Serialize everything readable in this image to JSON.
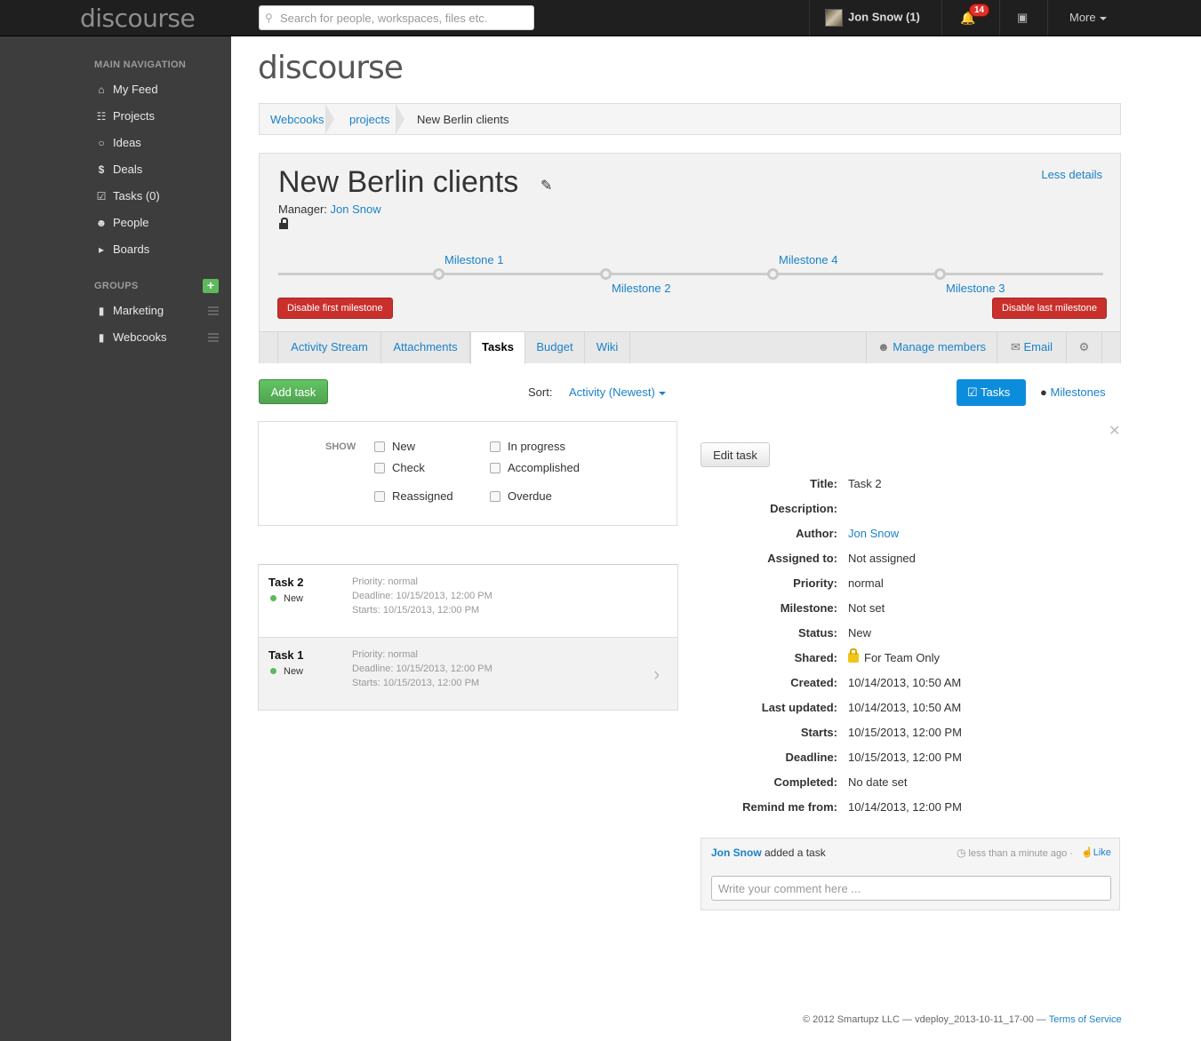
{
  "topbar": {
    "logo": "discourse",
    "search_placeholder": "Search for people, workspaces, files etc.",
    "user": "Jon Snow (1)",
    "notifications_count": "14",
    "more_label": "More"
  },
  "sidebar": {
    "main_nav_header": "MAIN NAVIGATION",
    "items": [
      {
        "label": "My Feed",
        "icon": "home-icon"
      },
      {
        "label": "Projects",
        "icon": "file-icon"
      },
      {
        "label": "Ideas",
        "icon": "lightbulb-icon"
      },
      {
        "label": "Deals",
        "icon": "dollar-icon"
      },
      {
        "label": "Tasks (0)",
        "icon": "check-square-icon"
      },
      {
        "label": "People",
        "icon": "users-icon"
      },
      {
        "label": "Boards",
        "icon": "megaphone-icon"
      }
    ],
    "groups_header": "GROUPS",
    "groups": [
      {
        "label": "Marketing",
        "icon": "bookmark-icon"
      },
      {
        "label": "Webcooks",
        "icon": "bookmark-icon"
      }
    ]
  },
  "main": {
    "logo": "discourse",
    "breadcrumb": [
      "Webcooks",
      "projects",
      "New Berlin clients"
    ],
    "project": {
      "title": "New Berlin clients",
      "less_details": "Less details",
      "manager_label": "Manager:",
      "manager_name": "Jon Snow",
      "milestones": [
        "Milestone 1",
        "Milestone 2",
        "Milestone 4",
        "Milestone 3"
      ],
      "disable_first": "Disable first milestone",
      "disable_last": "Disable last milestone"
    },
    "tabs": [
      "Activity Stream",
      "Attachments",
      "Tasks",
      "Budget",
      "Wiki"
    ],
    "active_tab": "Tasks",
    "tab_actions": {
      "manage_members": "Manage members",
      "email": "Email"
    },
    "add_task": "Add task",
    "sort_label": "Sort:",
    "sort_value": "Activity (Newest)",
    "view_tasks": "Tasks",
    "view_milestones": "Milestones",
    "filter": {
      "show_label": "SHOW",
      "options": [
        "New",
        "In progress",
        "Check",
        "Accomplished",
        "Reassigned",
        "Overdue"
      ]
    },
    "tasks": [
      {
        "name": "Task 2",
        "status": "New",
        "priority": "Priority: normal",
        "deadline": "Deadline: 10/15/2013, 12:00 PM",
        "starts": "Starts: 10/15/2013, 12:00 PM"
      },
      {
        "name": "Task 1",
        "status": "New",
        "priority": "Priority: normal",
        "deadline": "Deadline: 10/15/2013, 12:00 PM",
        "starts": "Starts: 10/15/2013, 12:00 PM"
      }
    ],
    "detail": {
      "edit_task": "Edit task",
      "fields": [
        {
          "k": "Title:",
          "v": "Task 2"
        },
        {
          "k": "Description:",
          "v": ""
        },
        {
          "k": "Author:",
          "v": "Jon Snow"
        },
        {
          "k": "Assigned to:",
          "v": "Not assigned"
        },
        {
          "k": "Priority:",
          "v": "normal"
        },
        {
          "k": "Milestone:",
          "v": "Not set"
        },
        {
          "k": "Status:",
          "v": "New"
        },
        {
          "k": "Shared:",
          "v": "For Team Only"
        },
        {
          "k": "Created:",
          "v": "10/14/2013, 10:50 AM"
        },
        {
          "k": "Last updated:",
          "v": "10/14/2013, 10:50 AM"
        },
        {
          "k": "Starts:",
          "v": "10/15/2013, 12:00 PM"
        },
        {
          "k": "Deadline:",
          "v": "10/15/2013, 12:00 PM"
        },
        {
          "k": "Completed:",
          "v": "No date set"
        },
        {
          "k": "Remind me from:",
          "v": "10/14/2013, 12:00 PM"
        }
      ]
    },
    "activity": {
      "author": "Jon Snow",
      "action": " added a task",
      "time": "less than a minute ago",
      "like": "Like",
      "comment_placeholder": "Write your comment here ..."
    }
  },
  "footer": {
    "text": "© 2012 Smartupz LLC — vdeploy_2013-10-11_17-00 — ",
    "terms": "Terms of Service"
  }
}
